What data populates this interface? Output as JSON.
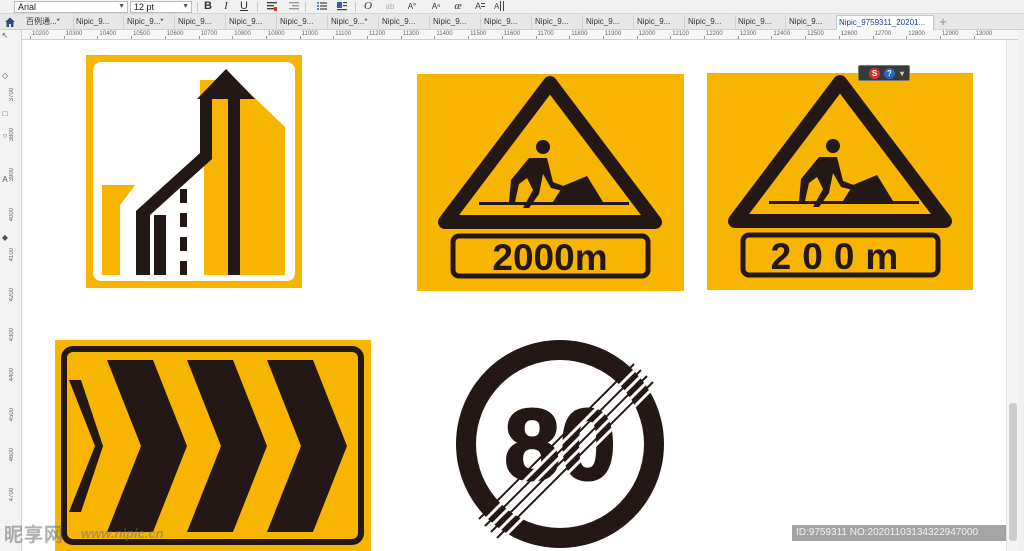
{
  "toolbar": {
    "font_name": "Arial",
    "font_size": "12 pt",
    "bold_label": "B",
    "italic_label": "I",
    "underline_label": "U",
    "tool_icons": [
      "align-icon",
      "bullets-icon",
      "dropcap-icon",
      "frame-icon",
      "char-format-icon",
      "glyph-icon",
      "text-icon",
      "columns-icon"
    ]
  },
  "tabs": [
    {
      "label": "百例通...*"
    },
    {
      "label": "Nipic_9..."
    },
    {
      "label": "Nipic_9...*"
    },
    {
      "label": "Nipic_9..."
    },
    {
      "label": "Nipic_9..."
    },
    {
      "label": "Nipic_9..."
    },
    {
      "label": "Nipic_9...*"
    },
    {
      "label": "Nipic_9..."
    },
    {
      "label": "Nipic_9..."
    },
    {
      "label": "Nipic_9..."
    },
    {
      "label": "Nipic_9..."
    },
    {
      "label": "Nipic_9..."
    },
    {
      "label": "Nipic_9..."
    },
    {
      "label": "Nipic_9..."
    },
    {
      "label": "Nipic_9..."
    },
    {
      "label": "Nipic_9..."
    },
    {
      "label": "Nipic_9759311_20201..."
    }
  ],
  "active_tab_index": 16,
  "ruler": {
    "horizontal": [
      "10200",
      "10300",
      "10400",
      "10500",
      "10600",
      "10700",
      "10800",
      "10900",
      "11000",
      "11100",
      "11200",
      "11300",
      "11400",
      "11500",
      "11600",
      "11700",
      "11800",
      "11900",
      "12000",
      "12100",
      "12200",
      "12300",
      "12400",
      "12500",
      "12600",
      "12700",
      "12800",
      "12900",
      "13000"
    ],
    "vertical": [
      "3700",
      "3800",
      "3900",
      "4000",
      "4100",
      "4200",
      "4300",
      "4400",
      "4500",
      "4600",
      "4700"
    ]
  },
  "signs": {
    "sign1_distance": "2000m",
    "sign2_distance": "200m",
    "speed_limit": "80"
  },
  "colors": {
    "sign_yellow": "#f7b500",
    "sign_black": "#231815"
  },
  "watermark": {
    "logo": "昵享网",
    "url": "www.nipic.cn",
    "id_text": "ID:9759311 NO:20201103134322947000"
  }
}
